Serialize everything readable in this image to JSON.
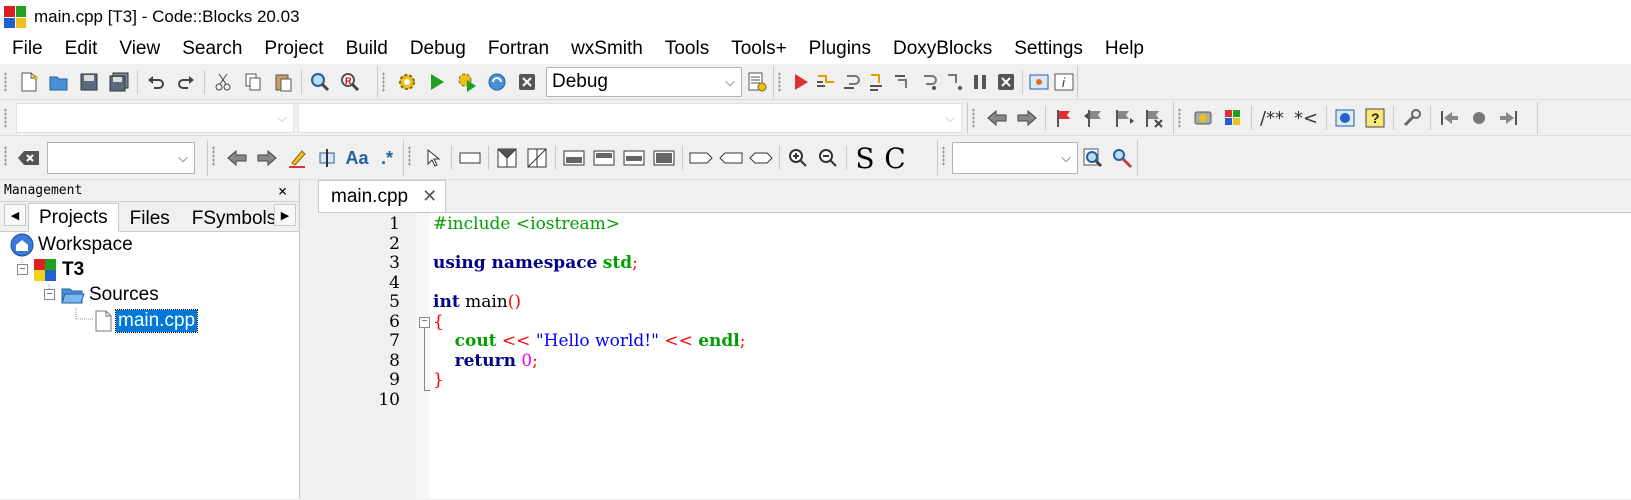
{
  "window": {
    "title": "main.cpp [T3] - Code::Blocks 20.03",
    "logo_colors": [
      "#d92020",
      "#20a020",
      "#2060d0",
      "#f0c020"
    ]
  },
  "menu": [
    "File",
    "Edit",
    "View",
    "Search",
    "Project",
    "Build",
    "Debug",
    "Fortran",
    "wxSmith",
    "Tools",
    "Tools+",
    "Plugins",
    "DoxyBlocks",
    "Settings",
    "Help"
  ],
  "toolbar": {
    "build_target": "Debug",
    "doxy_comment": "/**",
    "doxy_line": "*<",
    "search_letters": [
      "S",
      "C"
    ],
    "regex_label": ".*",
    "case_label": "Aa"
  },
  "management": {
    "title": "Management",
    "close": "×",
    "tabs": [
      "Projects",
      "Files",
      "FSymbols"
    ],
    "active_tab": "Projects",
    "tree": {
      "workspace": "Workspace",
      "project": "T3",
      "folder": "Sources",
      "file": "main.cpp"
    }
  },
  "editor": {
    "tab_label": "main.cpp",
    "tab_close": "✕",
    "line_numbers": [
      "1",
      "2",
      "3",
      "4",
      "5",
      "6",
      "7",
      "8",
      "9",
      "10"
    ],
    "code": {
      "l1": "#include <iostream>",
      "l3_kw": "using namespace",
      "l3_id": "std",
      "l3_end": ";",
      "l5_kw": "int",
      "l5_id": " main",
      "l5_paren": "()",
      "l6": "{",
      "l7_indent": "    ",
      "l7_cout": "cout",
      "l7_op1": " << ",
      "l7_str": "\"Hello world!\"",
      "l7_op2": " << ",
      "l7_endl": "endl",
      "l7_semi": ";",
      "l8_indent": "    ",
      "l8_kw": "return",
      "l8_num": " 0",
      "l8_semi": ";",
      "l9": "}"
    }
  },
  "colors": {
    "preprocessor": "#00a000",
    "keyword": "#00008b",
    "operator": "#ff0000",
    "string": "#0000ff",
    "selection": "#0078d7"
  }
}
